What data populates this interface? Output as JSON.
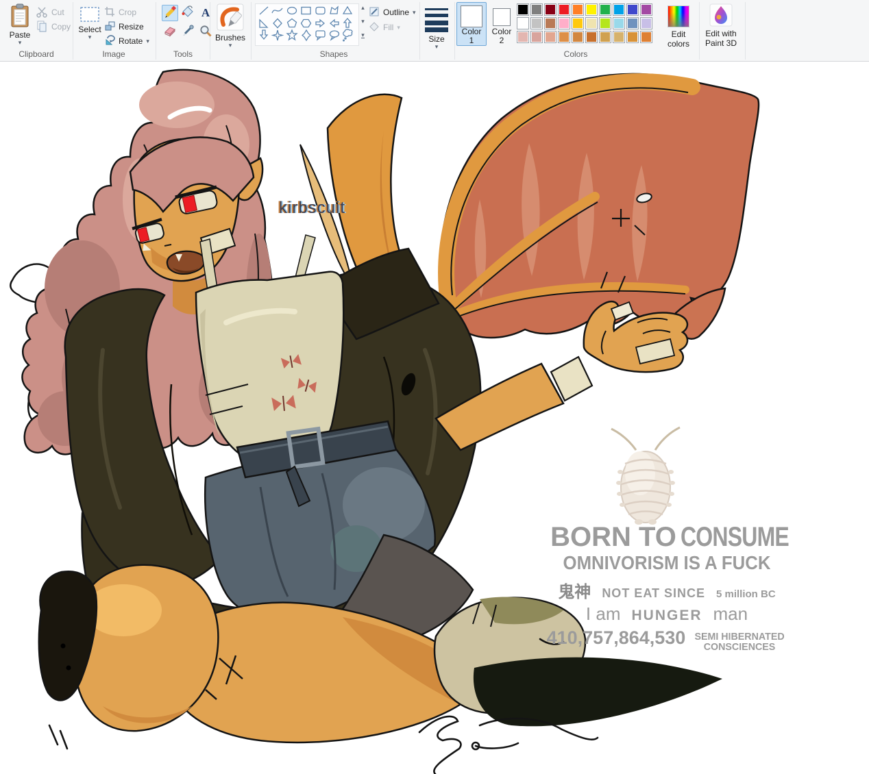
{
  "ribbon": {
    "clipboard": {
      "label": "Clipboard",
      "paste": "Paste",
      "cut": "Cut",
      "copy": "Copy"
    },
    "image": {
      "label": "Image",
      "select": "Select",
      "crop": "Crop",
      "resize": "Resize",
      "rotate": "Rotate"
    },
    "tools": {
      "label": "Tools"
    },
    "brushes": {
      "label": "Brushes"
    },
    "shapes": {
      "label": "Shapes",
      "outline": "Outline",
      "fill": "Fill"
    },
    "size": {
      "label": "Size"
    },
    "colors": {
      "label": "Colors",
      "color1_line1": "Color",
      "color1_line2": "1",
      "color2_line1": "Color",
      "color2_line2": "2",
      "edit_line1": "Edit",
      "edit_line2": "colors"
    },
    "paint3d": {
      "line1": "Edit with",
      "line2": "Paint 3D"
    }
  },
  "colors": {
    "color1": "#FFFFFF",
    "color2": "#FFFFFF",
    "selection_bg": "#CBE2F6",
    "selection_border": "#70A8D8",
    "ribbon_bg": "#F5F6F7",
    "palette": [
      "#000000",
      "#7F7F7F",
      "#880015",
      "#ED1C24",
      "#FF7F27",
      "#FFF200",
      "#22B14C",
      "#00A2E8",
      "#3F48CC",
      "#A349A4",
      "#FFFFFF",
      "#C3C3C3",
      "#B97A57",
      "#FFAEC9",
      "#FFC90E",
      "#EFE4B0",
      "#B5E61D",
      "#99D9EA",
      "#7092BE",
      "#C8BFE7",
      "#E3B6B0",
      "#D8A49D",
      "#E2A690",
      "#DD8F47",
      "#D28740",
      "#C7702D",
      "#D0A150",
      "#D6B26C",
      "#D89238",
      "#DE8034"
    ]
  },
  "canvas": {
    "signature": "kirbscuit",
    "meme": {
      "born_to": "BORN TO",
      "consume": "CONSUME",
      "line2": "OMNIVORISM IS A FUCK",
      "kanji": "鬼神",
      "not_eat": "NOT EAT SINCE",
      "since": "5 million BC",
      "i_am": "I am",
      "hunger": "HUNGER",
      "man": "man",
      "number": "410,757,864,530",
      "semi": "SEMI HIBERNATED",
      "consciences": "CONSCIENCES"
    }
  },
  "art": {
    "hair": "#CB9087",
    "hair_shadow": "#B67E76",
    "hair_light": "#DBA89C",
    "skin": "#E1A351",
    "skin_light": "#F2BB66",
    "skin_shadow": "#D18B3E",
    "eye_red": "#EC1C24",
    "sclera": "#E9E5CF",
    "wing_bone": "#E0993F",
    "wing_membrane": "#C96F51",
    "wing_membrane_light": "#D68C6F",
    "jacket": "#37321F",
    "jacket_dark": "#2A2516",
    "tank": "#DBD5B4",
    "butterfly": "#C96C5B",
    "denim": "#57646F",
    "belt": "#39434D",
    "flap": "#5A5450",
    "shoe": "#CDC3A1",
    "shadow": "#161A10",
    "mouth": "#8A4A28",
    "bandage": "#E9E2C4",
    "outline": "#141414",
    "isopod": "#EFE7DD"
  }
}
